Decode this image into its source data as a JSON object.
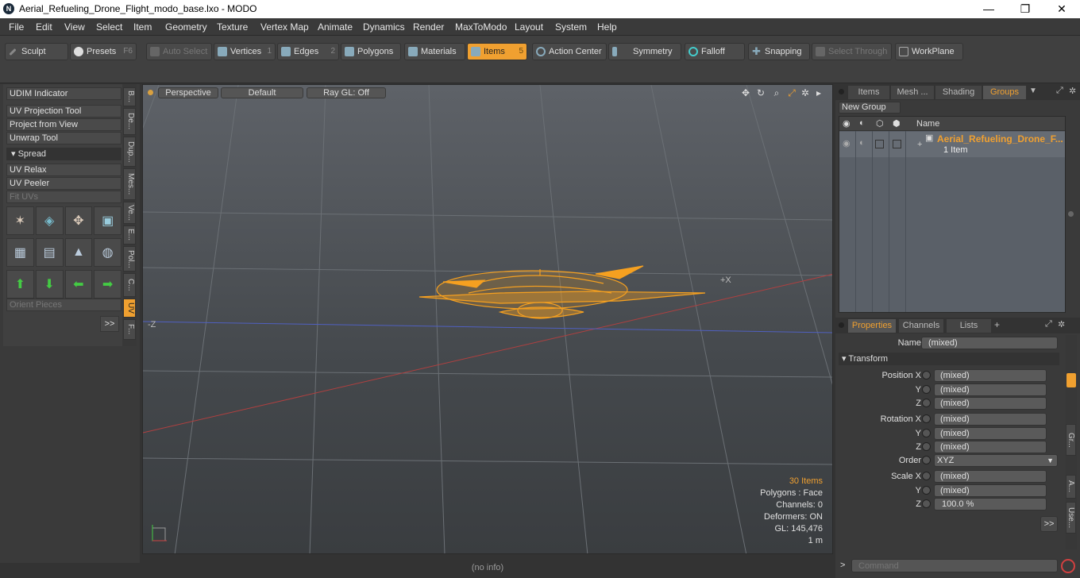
{
  "window": {
    "title": "Aerial_Refueling_Drone_Flight_modo_base.lxo - MODO",
    "logo": "N",
    "minimize": "—",
    "maximize": "❐",
    "close": "✕"
  },
  "menu": [
    "File",
    "Edit",
    "View",
    "Select",
    "Item",
    "Geometry",
    "Texture",
    "Vertex Map",
    "Animate",
    "Dynamics",
    "Render",
    "MaxToModo",
    "Layout",
    "System",
    "Help"
  ],
  "toolbar": {
    "sculpt": "Sculpt",
    "presets": "Presets",
    "presets_key": "F6",
    "auto_select": "Auto Select",
    "vertices": "Vertices",
    "vertices_key": "1",
    "edges": "Edges",
    "edges_key": "2",
    "polygons": "Polygons",
    "materials": "Materials",
    "items": "Items",
    "items_key": "5",
    "action_center": "Action Center",
    "symmetry": "Symmetry",
    "falloff": "Falloff",
    "snapping": "Snapping",
    "select_through": "Select Through",
    "workplane": "WorkPlane"
  },
  "left_panel": {
    "udim": "UDIM Indicator",
    "uv_projection": "UV Projection Tool",
    "project_from_view": "Project from View",
    "unwrap": "Unwrap Tool",
    "spread": "Spread",
    "uv_relax": "UV Relax",
    "uv_peeler": "UV Peeler",
    "fit_uvs": "Fit UVs",
    "orient_pieces": "Orient Pieces",
    "more": ">>",
    "vtabs": [
      "B...",
      "De...",
      "Dup...",
      "Mes...",
      "Ve...",
      "E...",
      "Pol...",
      "C...",
      "UV",
      "F..."
    ]
  },
  "viewport": {
    "perspective": "Perspective",
    "default": "Default",
    "raygl": "Ray GL: Off",
    "axis_x": "+X",
    "axis_z": "-Z",
    "stats": {
      "items": "30 Items",
      "polygons": "Polygons : Face",
      "channels": "Channels: 0",
      "deformers": "Deformers: ON",
      "gl": "GL: 145,476",
      "scale": "1 m"
    }
  },
  "status": "(no info)",
  "groups_panel": {
    "tabs": [
      "Items",
      "Mesh ...",
      "Shading",
      "Groups"
    ],
    "new_group": "New Group",
    "col_name": "Name",
    "group_name": "Aerial_Refueling_Drone_F...",
    "group_count": "1 Item"
  },
  "properties_panel": {
    "tabs": [
      "Properties",
      "Channels",
      "Lists"
    ],
    "add_tab": "+",
    "name_label": "Name",
    "name_value": "(mixed)",
    "transform": "Transform",
    "position_x": "Position X",
    "rotation_x": "Rotation X",
    "scale_x": "Scale X",
    "y": "Y",
    "z": "Z",
    "order": "Order",
    "order_value": "XYZ",
    "mixed": "(mixed)",
    "scale_z_value": "100.0 %",
    "more": ">>",
    "side_tabs": [
      "Gr...",
      "A...",
      "Use..."
    ]
  },
  "command": {
    "prompt": ">",
    "placeholder": "Command"
  },
  "colors": {
    "accent": "#f0a030",
    "mesh": "#f5a020"
  }
}
